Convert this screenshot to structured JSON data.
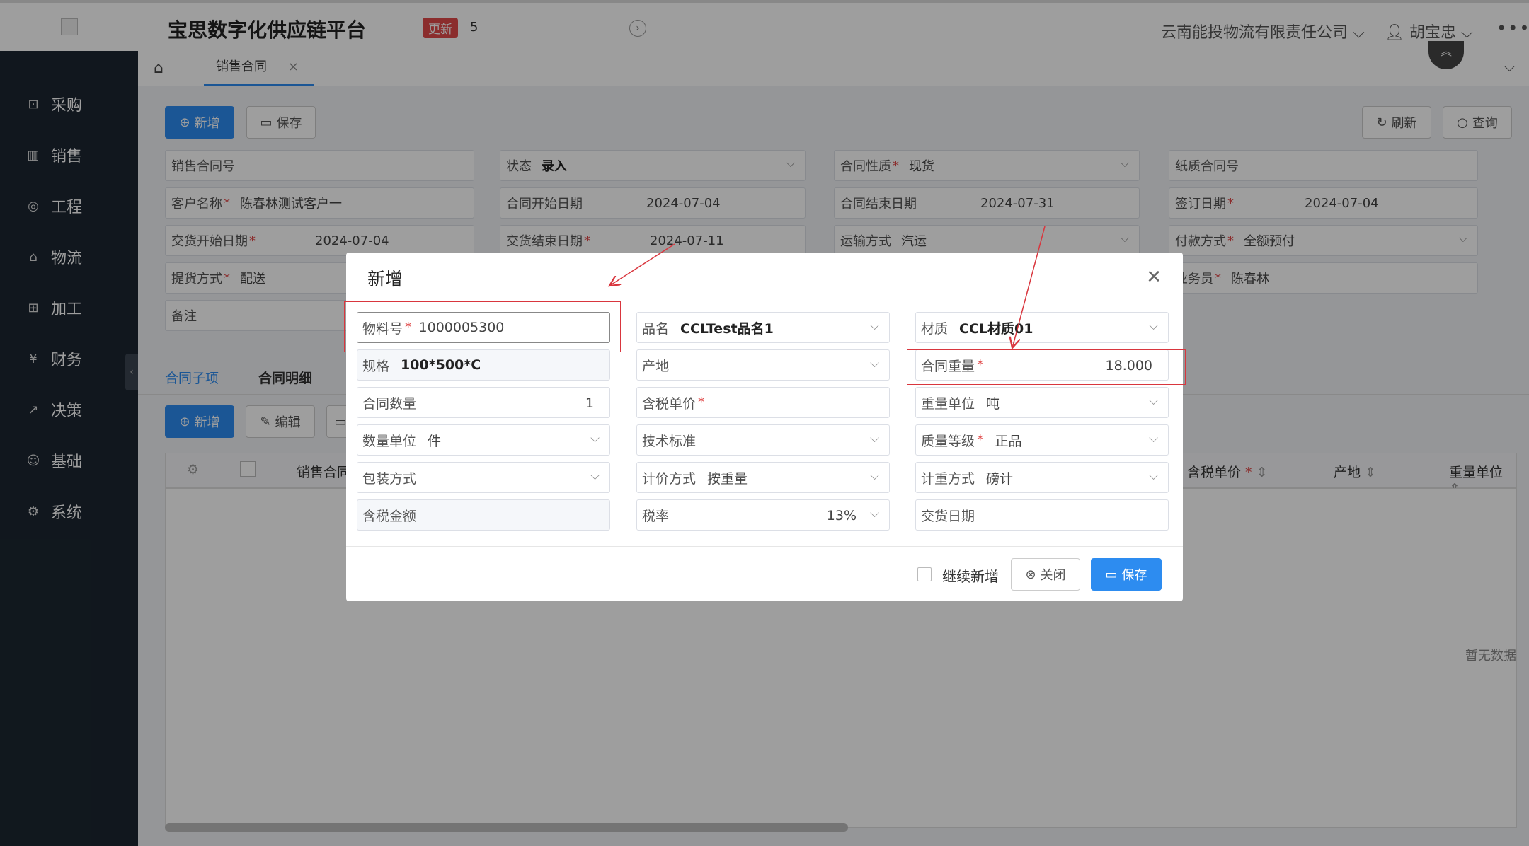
{
  "app": {
    "title": "宝思数字化供应链平台",
    "update_badge": "更新",
    "update_count": "5",
    "company": "云南能投物流有限责任公司",
    "user": "胡宝忠"
  },
  "sidebar": {
    "items": [
      {
        "label": "采购",
        "icon": "shopping-bag-icon"
      },
      {
        "label": "销售",
        "icon": "bar-chart-icon"
      },
      {
        "label": "工程",
        "icon": "compass-icon"
      },
      {
        "label": "物流",
        "icon": "home-icon"
      },
      {
        "label": "加工",
        "icon": "process-icon"
      },
      {
        "label": "财务",
        "icon": "yen-icon"
      },
      {
        "label": "决策",
        "icon": "line-chart-icon"
      },
      {
        "label": "基础",
        "icon": "smile-icon"
      },
      {
        "label": "系统",
        "icon": "gear-icon"
      }
    ]
  },
  "tabs": {
    "active": "销售合同",
    "close": "×"
  },
  "toolbar": {
    "add": "新增",
    "save": "保存",
    "refresh": "刷新",
    "query": "查询"
  },
  "form": {
    "contract_no": "销售合同号",
    "status_label": "状态",
    "status_value": "录入",
    "nature_label": "合同性质",
    "nature_value": "现货",
    "paper_no": "纸质合同号",
    "customer_label": "客户名称",
    "customer_value": "陈春林测试客户一",
    "start_label": "合同开始日期",
    "start_value": "2024-07-04",
    "end_label": "合同结束日期",
    "end_value": "2024-07-31",
    "sign_label": "签订日期",
    "sign_value": "2024-07-04",
    "delivery_start_label": "交货开始日期",
    "delivery_start_value": "2024-07-04",
    "delivery_end_label": "交货结束日期",
    "delivery_end_value": "2024-07-11",
    "transport_label": "运输方式",
    "transport_value": "汽运",
    "payment_label": "付款方式",
    "payment_value": "全额预付",
    "pickup_label": "提货方式",
    "pickup_value": "配送",
    "salesman_label": "业务员",
    "salesman_value": "陈春林",
    "remark_label": "备注"
  },
  "subtabs": {
    "items": "合同子项",
    "details": "合同明细"
  },
  "grid": {
    "add": "新增",
    "edit": "编辑",
    "col_contract": "销售合同",
    "col_price": "含税单价",
    "col_origin": "产地",
    "col_unit": "重量单位",
    "empty": "暂无数据"
  },
  "modal": {
    "title": "新增",
    "fields": {
      "material_no_label": "物料号",
      "material_no_value": "1000005300",
      "product_label": "品名",
      "product_value": "CCLTest品名1",
      "texture_label": "材质",
      "texture_value": "CCL材质01",
      "spec_label": "规格",
      "spec_value": "100*500*C",
      "origin_label": "产地",
      "weight_label": "合同重量",
      "weight_value": "18.000",
      "qty_label": "合同数量",
      "qty_value": "1",
      "tax_price_label": "含税单价",
      "weight_unit_label": "重量单位",
      "weight_unit_value": "吨",
      "qty_unit_label": "数量单位",
      "qty_unit_value": "件",
      "tech_label": "技术标准",
      "quality_label": "质量等级",
      "quality_value": "正品",
      "pack_label": "包装方式",
      "price_mode_label": "计价方式",
      "price_mode_value": "按重量",
      "weigh_mode_label": "计重方式",
      "weigh_mode_value": "磅计",
      "tax_amount_label": "含税金额",
      "tax_rate_label": "税率",
      "tax_rate_value": "13%",
      "delivery_date_label": "交货日期"
    },
    "continue_label": "继续新增",
    "close_label": "关闭",
    "save_label": "保存"
  },
  "colors": {
    "primary": "#2d8cf0",
    "sidebar": "#1c2631",
    "required": "#e04a4a",
    "annotation": "#d9363e"
  }
}
